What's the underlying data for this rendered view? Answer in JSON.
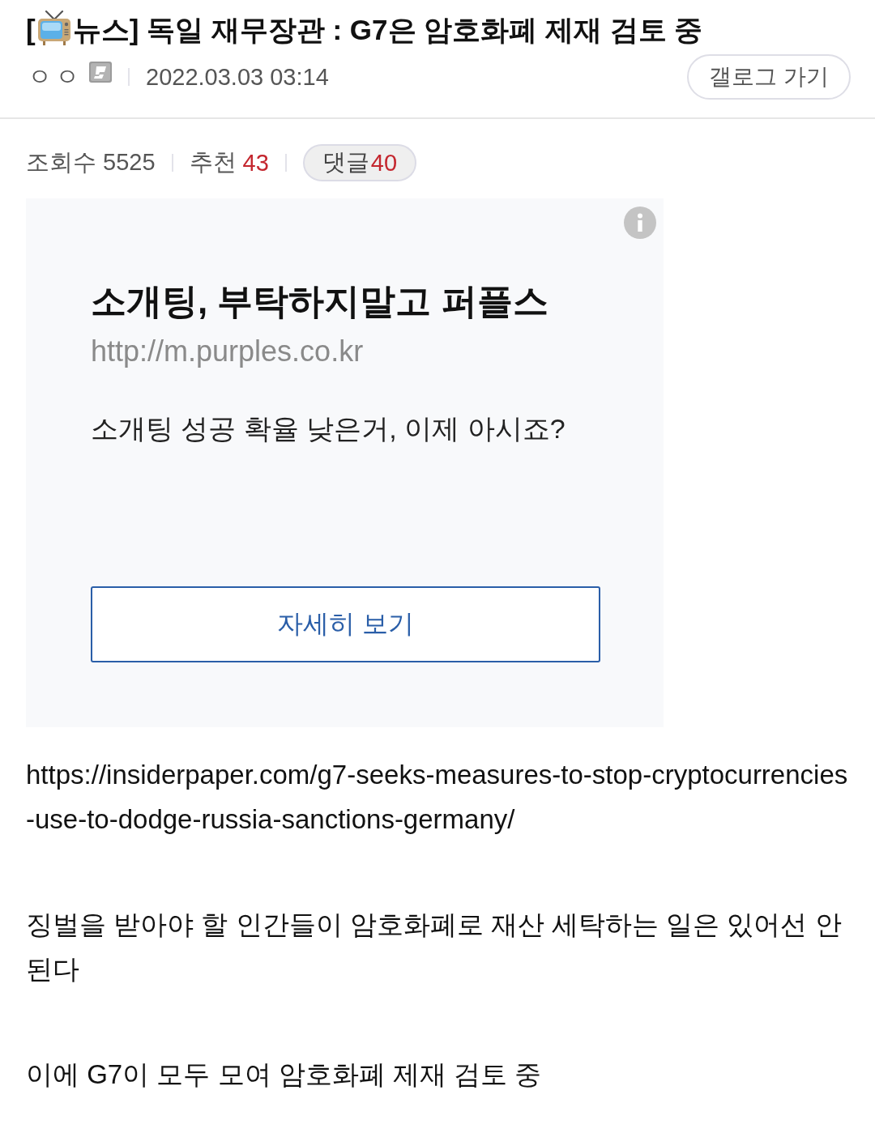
{
  "post": {
    "title_prefix": "[",
    "title": "뉴스] 독일 재무장관 : G7은 암호화폐 제재 검토 중",
    "author": "ㅇㅇ",
    "date": "2022.03.03 03:14",
    "gallog_button": "갤로그 가기"
  },
  "stats": {
    "views": "조회수 5525",
    "recommend_label": "추천",
    "recommend_count": "43",
    "comments_label": "댓글",
    "comments_count": "40"
  },
  "ad": {
    "title": "소개팅, 부탁하지말고 퍼플스",
    "url": "http://m.purples.co.kr",
    "description": "소개팅 성공 확율 낮은거, 이제 아시죠?",
    "button": "자세히 보기"
  },
  "body": [
    "https://insiderpaper.com/g7-seeks-measures-to-stop-cryptocurrencies-use-to-dodge-russia-sanctions-germany/",
    "징벌을 받아야 할 인간들이 암호화폐로 재산 세탁하는 일은 있어선 안 된다",
    "이에 G7이 모두 모여 암호화폐 제재 검토 중"
  ]
}
